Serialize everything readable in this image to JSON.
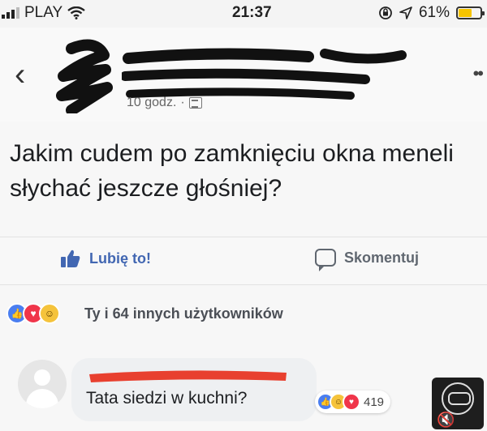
{
  "status_bar": {
    "carrier": "PLAY",
    "time": "21:37",
    "battery": "61%",
    "battery_level": 0.61,
    "icons": [
      "signal-bars-icon",
      "wifi-icon",
      "orientation-lock-icon",
      "location-arrow-icon",
      "battery-icon"
    ]
  },
  "header": {
    "back_icon": "chevron-left-icon",
    "more_icon": "more-dots-icon",
    "post_time": "10 godz.",
    "separator": "·",
    "audience_icon": "audience-icon"
  },
  "post": {
    "text": "Jakim cudem po zamknięciu okna meneli słychać jeszcze głośniej?"
  },
  "actions": {
    "like_label": "Lubię to!",
    "comment_label": "Skomentuj"
  },
  "reactions": {
    "summary": "Ty i 64 innych użytkowników",
    "types": [
      "like",
      "love",
      "haha"
    ]
  },
  "comment": {
    "text": "Tata siedzi w kuchni?",
    "reaction_count": "419",
    "reaction_types": [
      "like",
      "haha",
      "love"
    ]
  },
  "colors": {
    "facebook_blue": "#4267b2",
    "like_blue": "#4a7ef0",
    "love_red": "#f0354a",
    "haha_yellow": "#f5c33b",
    "redaction_red": "#e8402f",
    "battery_yellow": "#f5c400"
  }
}
